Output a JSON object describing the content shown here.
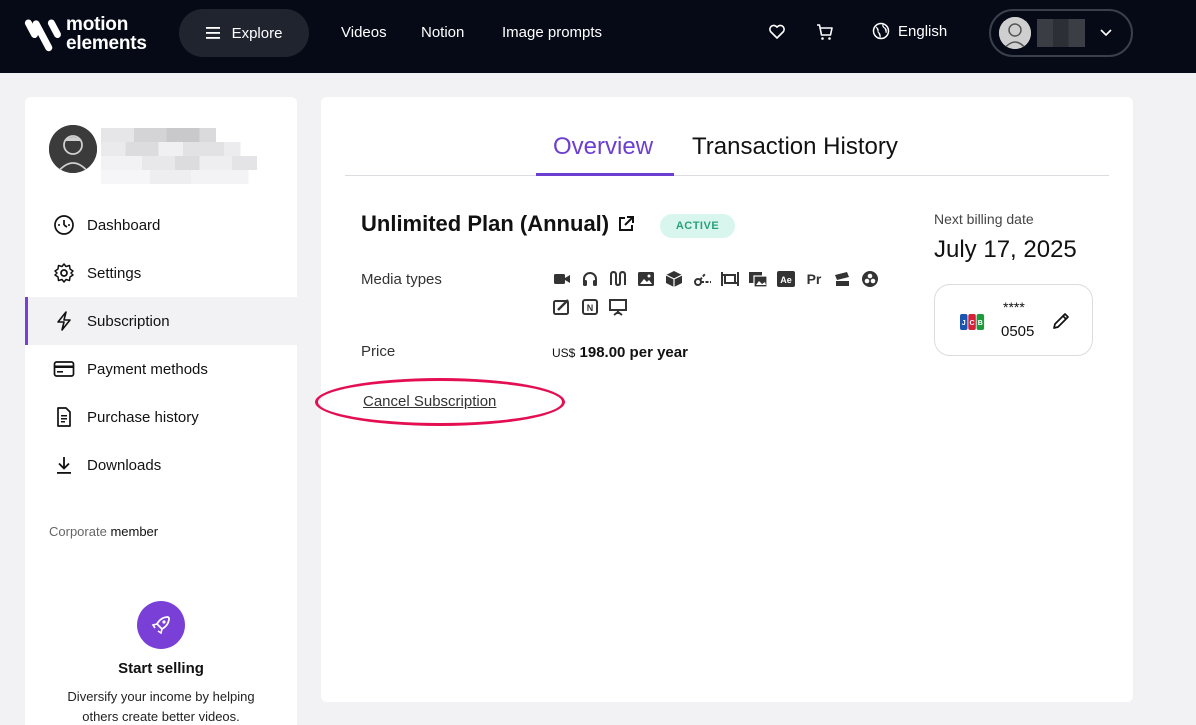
{
  "header": {
    "logo_line1": "motion",
    "logo_line2": "elements",
    "explore_label": "Explore",
    "nav": [
      "Videos",
      "Notion",
      "Image prompts"
    ],
    "language": "English",
    "icons": [
      "menu-icon",
      "heart-icon",
      "cart-icon",
      "globe-icon",
      "chevron-down-icon"
    ]
  },
  "sidebar": {
    "items": [
      {
        "label": "Dashboard",
        "icon": "dashboard-icon"
      },
      {
        "label": "Settings",
        "icon": "gear-icon"
      },
      {
        "label": "Subscription",
        "icon": "bolt-icon"
      },
      {
        "label": "Payment methods",
        "icon": "credit-card-icon"
      },
      {
        "label": "Purchase history",
        "icon": "receipt-icon"
      },
      {
        "label": "Downloads",
        "icon": "download-icon"
      }
    ],
    "active_item": "Subscription",
    "member_prefix": "Corporate",
    "member_suffix": "member",
    "sell_title": "Start selling",
    "sell_desc": "Diversify your income by helping others create better videos."
  },
  "tabs": {
    "overview": "Overview",
    "history": "Transaction History",
    "active": "Overview"
  },
  "plan": {
    "title": "Unlimited Plan (Annual)",
    "status": "ACTIVE",
    "media_label": "Media types",
    "media_icons": [
      "video-icon",
      "audio-icon",
      "music-icon",
      "image-icon",
      "3d-icon",
      "lottie-icon",
      "transform-icon",
      "gallery-icon",
      "after-effects-icon",
      "premiere-icon",
      "fcp-icon",
      "resolve-icon",
      "motion-icon",
      "notion-icon",
      "presentation-icon"
    ],
    "price_label": "Price",
    "currency": "US$",
    "price": "198.00 per year",
    "cancel_label": "Cancel Subscription"
  },
  "billing": {
    "label": "Next billing date",
    "date": "July 17, 2025",
    "card_mask": "****",
    "card_last4": "0505",
    "card_brand": "jcb-icon"
  },
  "colors": {
    "accent": "#6c3fd1",
    "badge_bg": "#d9f6ee",
    "badge_text": "#2aa07c",
    "highlight": "#e30f52",
    "header_bg": "#060a17"
  }
}
